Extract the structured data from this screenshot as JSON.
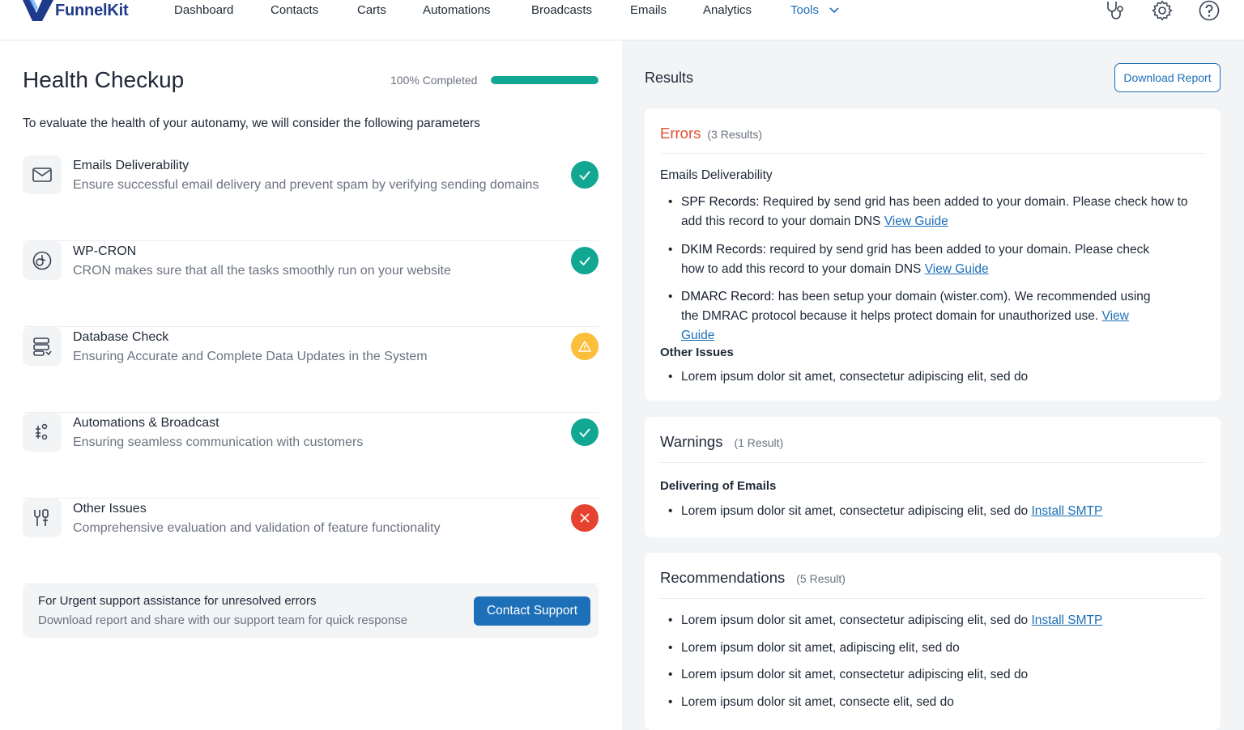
{
  "brand": {
    "name": "FunnelKit",
    "primary_color": "#1e3a8a",
    "accent_color": "#1d6fb8"
  },
  "nav": {
    "items": [
      {
        "label": "Dashboard"
      },
      {
        "label": "Contacts"
      },
      {
        "label": "Carts"
      },
      {
        "label": "Automations"
      },
      {
        "label": "Broadcasts"
      },
      {
        "label": "Emails"
      },
      {
        "label": "Analytics"
      },
      {
        "label": "Tools"
      }
    ],
    "active": "Tools",
    "icons": [
      "stethoscope-icon",
      "gear-icon",
      "help-icon"
    ]
  },
  "left": {
    "title": "Health Checkup",
    "progress": {
      "label": "100% Completed",
      "value": 100,
      "color": "#12a792"
    },
    "intro": "To evaluate the health of your autonamy, we will consider the following parameters",
    "checks": [
      {
        "icon": "mail-icon",
        "title": "Emails Deliverability",
        "desc": "Ensure successful email delivery and prevent spam by verifying sending domains",
        "status": "success",
        "status_color": "#12a792"
      },
      {
        "icon": "cron-icon",
        "title": "WP-CRON",
        "desc": "CRON makes sure that all the tasks smoothly run on your website",
        "status": "success",
        "status_color": "#12a792"
      },
      {
        "icon": "database-icon",
        "title": "Database Check",
        "desc": "Ensuring Accurate and Complete Data Updates in the System",
        "status": "warning",
        "status_color": "#fbbf3c"
      },
      {
        "icon": "automation-icon",
        "title": "Automations & Broadcast",
        "desc": "Ensuring seamless communication with customers",
        "status": "success",
        "status_color": "#12a792"
      },
      {
        "icon": "tools-icon",
        "title": "Other Issues",
        "desc": "Comprehensive evaluation and validation of feature functionality",
        "status": "error",
        "status_color": "#e5432f"
      }
    ],
    "support": {
      "title": "For Urgent support assistance for unresolved errors",
      "desc": "Download report and share with our support team for quick response",
      "button": "Contact Support"
    }
  },
  "right": {
    "title": "Results",
    "download_button": "Download Report",
    "errors": {
      "title": "Errors",
      "count": "(3 Results)",
      "color": "#e0502f",
      "section1_title": "Emails Deliverability",
      "items": [
        {
          "label": "SPF Records:",
          "line1": "Required by send grid has been added to your domain. Please check how to",
          "line2": "add  this record to your domain DNS",
          "link": "View Guide"
        },
        {
          "label": "DKIM Records:",
          "line1": "required by send grid has been added to your domain. Please check",
          "line2": "how to add  this record to your domain DNS",
          "link": "View Guide"
        },
        {
          "label": "DMARC Record:",
          "line1": "has been setup your domain (wister.com). We recommended using",
          "line2": "the DMRAC  protocol  because it helps protect domain for unauthorized use.",
          "link_a": "View",
          "link_b": "Guide"
        }
      ],
      "section2_title": "Other Issues",
      "other": "Lorem ipsum dolor sit amet, consectetur adipiscing elit, sed do"
    },
    "warnings": {
      "title": "Warnings",
      "count": "(1 Result)",
      "section_title": "Delivering of Emails",
      "item": "Lorem ipsum dolor sit amet, consectetur adipiscing elit, sed do",
      "link": "Install SMTP"
    },
    "recommendations": {
      "title": "Recommendations",
      "count": "(5 Result)",
      "items": [
        {
          "text": "Lorem ipsum dolor sit amet, consectetur adipiscing elit, sed do",
          "link": "Install SMTP"
        },
        {
          "text": "Lorem ipsum dolor sit amet,  adipiscing elit, sed do"
        },
        {
          "text": "Lorem ipsum dolor sit amet, consectetur adipiscing elit, sed do"
        },
        {
          "text": "Lorem ipsum dolor sit amet, consecte elit, sed do"
        }
      ]
    }
  }
}
